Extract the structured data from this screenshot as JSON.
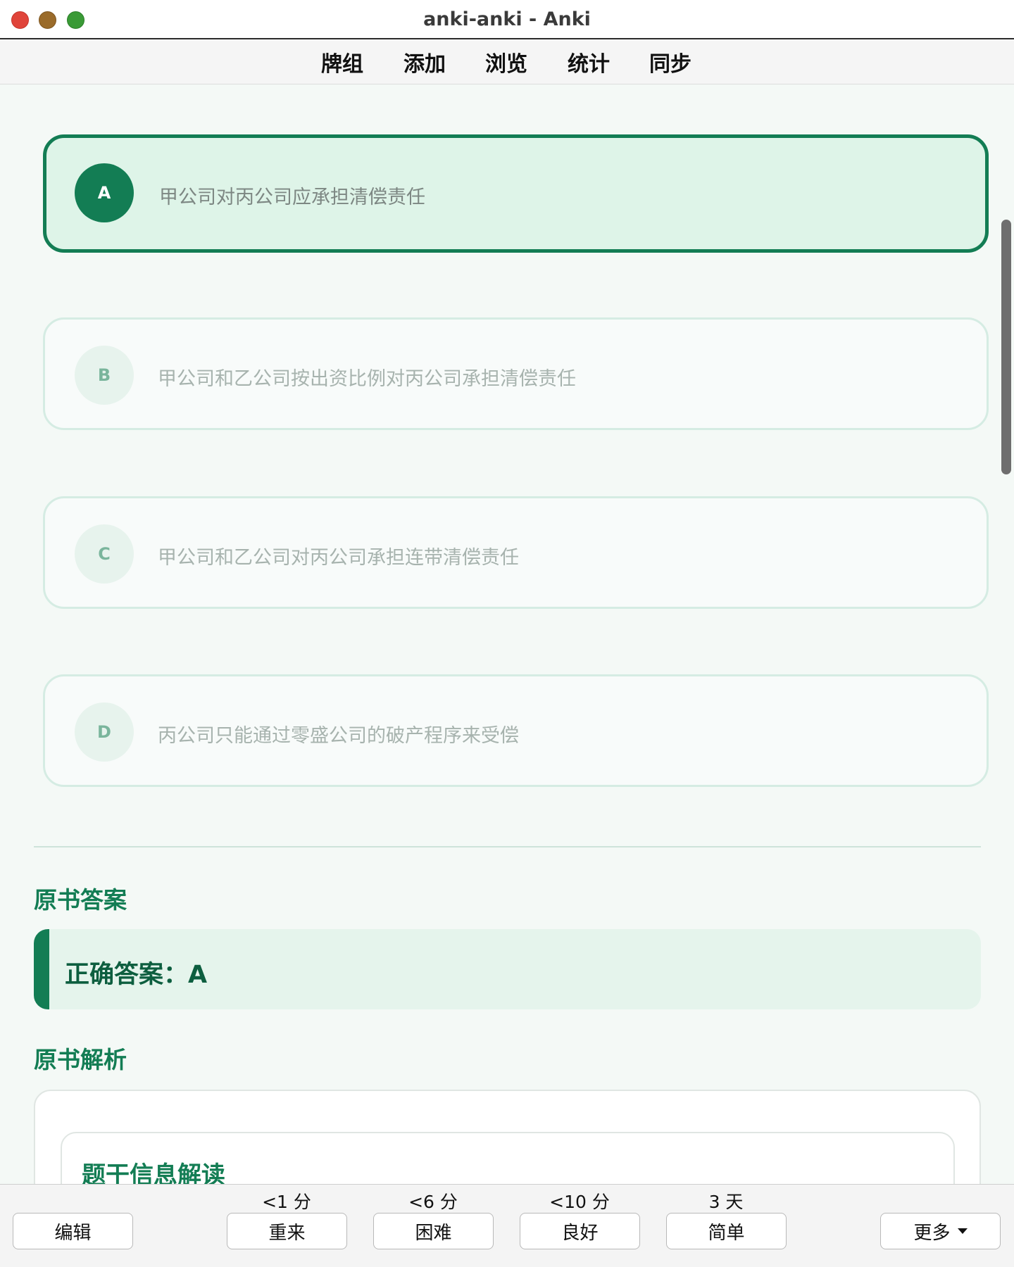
{
  "window": {
    "title": "anki-anki - Anki"
  },
  "toolbar": {
    "items": [
      "牌组",
      "添加",
      "浏览",
      "统计",
      "同步"
    ]
  },
  "options": [
    {
      "letter": "A",
      "text": "甲公司对丙公司应承担清偿责任",
      "selected": true
    },
    {
      "letter": "B",
      "text": "甲公司和乙公司按出资比例对丙公司承担清偿责任",
      "selected": false
    },
    {
      "letter": "C",
      "text": "甲公司和乙公司对丙公司承担连带清偿责任",
      "selected": false
    },
    {
      "letter": "D",
      "text": "丙公司只能通过零盛公司的破产程序来受偿",
      "selected": false
    }
  ],
  "answer_section": {
    "title": "原书答案",
    "answer_text": "正确答案：A"
  },
  "analysis_section": {
    "title": "原书解析",
    "subtitle": "题干信息解读"
  },
  "bottom": {
    "edit_label": "编辑",
    "more_label": "更多",
    "ease_buttons": [
      {
        "interval": "<1 分",
        "label": "重来"
      },
      {
        "interval": "<6 分",
        "label": "困难"
      },
      {
        "interval": "<10 分",
        "label": "良好"
      },
      {
        "interval": "3 天",
        "label": "简单"
      }
    ]
  },
  "colors": {
    "accent": "#137d54",
    "selected_bg": "#def4e8",
    "page_bg": "#f4f9f6"
  },
  "icons": {
    "more_dropdown": "caret-down-icon"
  }
}
